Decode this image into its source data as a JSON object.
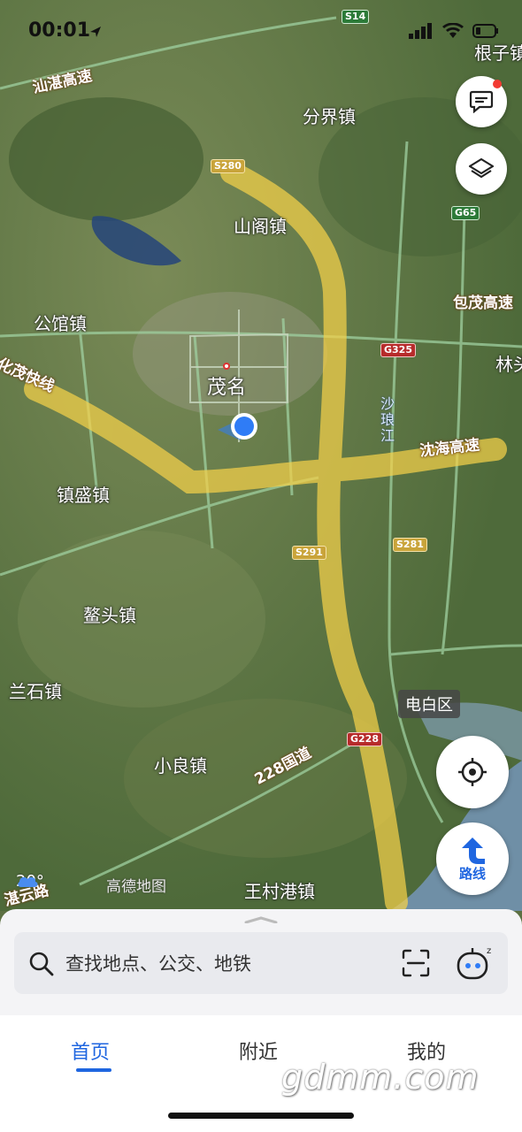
{
  "status_bar": {
    "time": "00:01"
  },
  "map": {
    "places": [
      "根子镇",
      "分界镇",
      "山阁镇",
      "公馆镇",
      "茂名",
      "林头",
      "镇盛镇",
      "鳌头镇",
      "兰石镇",
      "小良镇",
      "王村港镇"
    ],
    "district": "电白区",
    "river": "沙琅江",
    "highways": [
      "汕湛高速",
      "化茂快线",
      "沈海高速",
      "包茂高速",
      "228国道",
      "湛云路"
    ],
    "shields": [
      "S14",
      "S280",
      "G65",
      "G325",
      "S291",
      "S281",
      "G228"
    ],
    "colors": {
      "overlay_yellow": "#f5d14a",
      "location_blue": "#2f7cf6",
      "shield_red": "#b72b2b"
    }
  },
  "controls": {
    "messages": "message-icon",
    "layers": "layers-icon",
    "locate": "locate-icon",
    "route_label": "路线"
  },
  "weather": {
    "temperature": "20°"
  },
  "brand": "高德地图",
  "search": {
    "placeholder": "查找地点、公交、地铁"
  },
  "tabs": [
    {
      "label": "首页",
      "active": true
    },
    {
      "label": "附近",
      "active": false
    },
    {
      "label": "我的",
      "active": false
    }
  ],
  "watermark": "gdmm.com"
}
